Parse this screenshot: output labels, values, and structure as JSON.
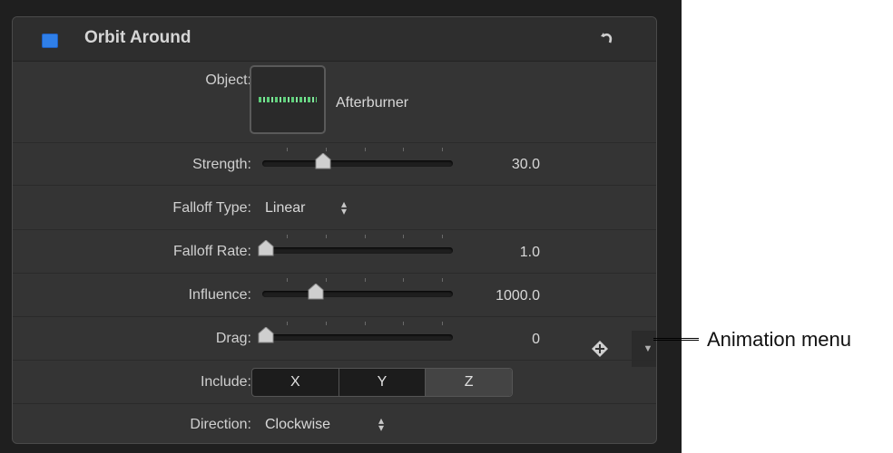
{
  "header": {
    "title": "Orbit Around",
    "enable_icon": "checkbox-icon",
    "reset_icon": "reset-arrow-icon",
    "accent_color": "#2f7fe8"
  },
  "object": {
    "label": "Object:",
    "value": "Afterburner"
  },
  "strength": {
    "label": "Strength:",
    "value": "30.0",
    "slider_fraction": 0.32
  },
  "falloff_type": {
    "label": "Falloff Type:",
    "value": "Linear"
  },
  "falloff_rate": {
    "label": "Falloff Rate:",
    "value": "1.0",
    "slider_fraction": 0.02
  },
  "influence": {
    "label": "Influence:",
    "value": "1000.0",
    "slider_fraction": 0.28
  },
  "drag": {
    "label": "Drag:",
    "value": "0",
    "slider_fraction": 0.02,
    "keyframe_icon": "add-keyframe-icon",
    "menu_icon": "chevron-down-icon"
  },
  "include": {
    "label": "Include:",
    "options": [
      "X",
      "Y",
      "Z"
    ],
    "selected": "Z"
  },
  "direction": {
    "label": "Direction:",
    "value": "Clockwise"
  },
  "callout": {
    "text": "Animation menu"
  }
}
